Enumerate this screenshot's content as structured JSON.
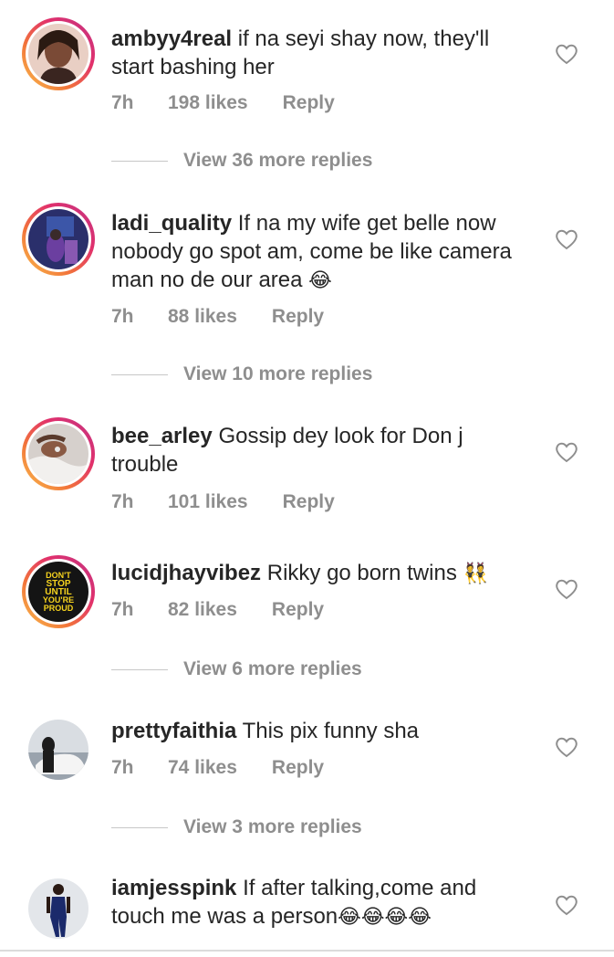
{
  "comments": [
    {
      "username": "ambyy4real",
      "text": "if na seyi shay now, they'll start bashing her",
      "time": "7h",
      "likes": "198 likes",
      "reply": "Reply",
      "view_replies": "View 36 more replies",
      "avatar_colors": [
        "#e9cfc4",
        "#5a3a2c"
      ]
    },
    {
      "username": "ladi_quality",
      "text": "If na my wife get belle now nobody go spot am, come be like camera man no de our area",
      "emoji": "😂",
      "time": "7h",
      "likes": "88 likes",
      "reply": "Reply",
      "view_replies": "View 10 more replies",
      "avatar_colors": [
        "#2a2f6b",
        "#b06ad0"
      ]
    },
    {
      "username": "bee_arley",
      "text": "Gossip dey look for Don j trouble",
      "time": "7h",
      "likes": "101 likes",
      "reply": "Reply",
      "avatar_colors": [
        "#c9c3bf",
        "#6b4a3a"
      ]
    },
    {
      "username": "lucidjhayvibez",
      "text": "Rikky go born twins",
      "emoji": "👯",
      "time": "7h",
      "likes": "82 likes",
      "reply": "Reply",
      "view_replies": "View 6 more replies",
      "avatar_text": [
        "DON'T",
        "STOP",
        "UNTIL",
        "YOU'RE",
        "PROUD"
      ],
      "avatar_colors": [
        "#141414",
        "#f5d21e"
      ]
    },
    {
      "username": "prettyfaithia",
      "text": "This pix funny sha",
      "time": "7h",
      "likes": "74 likes",
      "reply": "Reply",
      "view_replies": "View 3 more replies",
      "avatar_colors": [
        "#d9dde2",
        "#1c1c1c"
      ]
    },
    {
      "username": "iamjesspink",
      "text": "If after talking,come and touch me was a person",
      "emoji": "😂😂😂😂",
      "avatar_colors": [
        "#e3e6ea",
        "#1b2a6b"
      ]
    }
  ],
  "icons": {
    "like": "heart-outline-icon"
  },
  "colors": {
    "ring_start": "#f9c14d",
    "ring_end": "#c13584",
    "meta": "#8e8e8e",
    "text": "#262626"
  }
}
